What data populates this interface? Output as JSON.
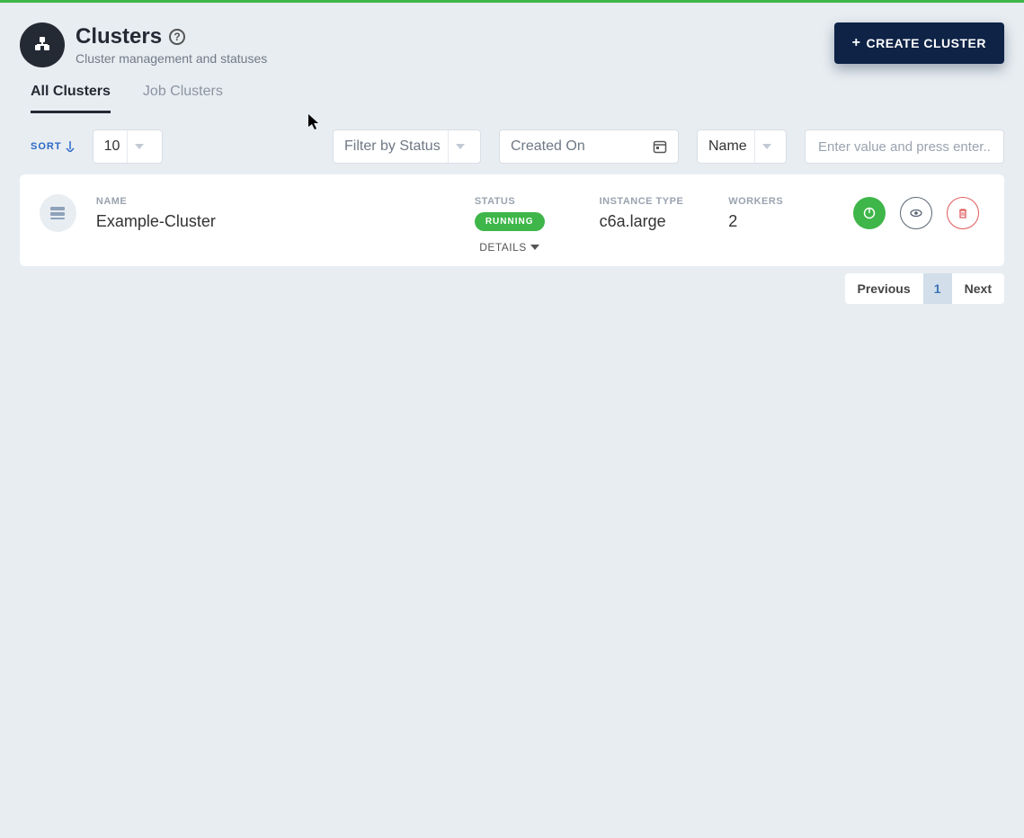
{
  "header": {
    "title": "Clusters",
    "subtitle": "Cluster management and statuses",
    "help_tooltip": "?",
    "create_label": "CREATE CLUSTER"
  },
  "tabs": [
    {
      "label": "All Clusters",
      "active": true
    },
    {
      "label": "Job Clusters",
      "active": false
    }
  ],
  "filters": {
    "sort_label": "SORT",
    "page_size_value": "10",
    "status_placeholder": "Filter by Status",
    "date_placeholder": "Created On",
    "search_field_value": "Name",
    "search_input_placeholder": "Enter value and press enter..."
  },
  "columns": {
    "name": "NAME",
    "status": "STATUS",
    "instance_type": "INSTANCE TYPE",
    "workers": "WORKERS"
  },
  "clusters": [
    {
      "name": "Example-Cluster",
      "status": "RUNNING",
      "instance_type": "c6a.large",
      "workers": "2"
    }
  ],
  "details_label": "DETAILS",
  "pager": {
    "prev": "Previous",
    "page": "1",
    "next": "Next"
  },
  "colors": {
    "accent_green": "#3eb649",
    "primary_dark": "#0e2346",
    "danger": "#e05a5a"
  }
}
